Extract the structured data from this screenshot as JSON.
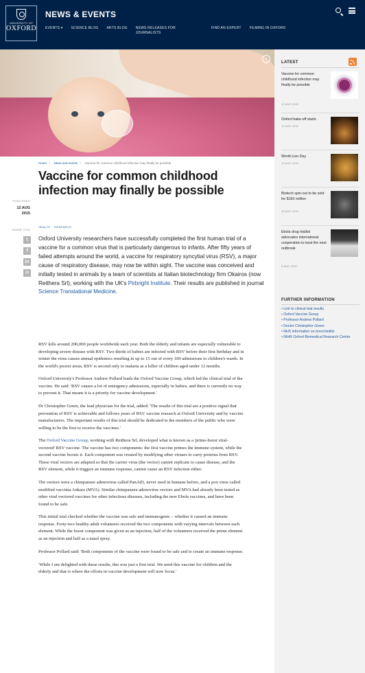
{
  "header": {
    "logo_top": "UNIVERSITY OF",
    "logo_main": "OXFORD",
    "section_title": "NEWS & EVENTS",
    "nav": [
      {
        "label": "EVENTS ▾"
      },
      {
        "label": "SCIENCE BLOG"
      },
      {
        "label": "ARTS BLOG"
      },
      {
        "label": "NEWS RELEASES FOR JOURNALISTS"
      },
      {
        "label": "FIND AN EXPERT"
      },
      {
        "label": "FILMING IN OXFORD"
      }
    ],
    "search_icon": "search-icon",
    "menu_icon": "menu-icon"
  },
  "hero": {
    "info_glyph": "i"
  },
  "breadcrumb": {
    "home": "Home",
    "section": "News and events",
    "current": "Vaccine for common childhood infection may finally be possible",
    "separator": "〉"
  },
  "article": {
    "published_label": "PUBLISHED",
    "date_line1": "12 AUG",
    "date_line2": "2015",
    "share_label": "SHARE THIS",
    "share_icons": [
      "twitter-icon",
      "facebook-icon",
      "linkedin-icon",
      "email-icon"
    ],
    "share_glyphs": [
      "t",
      "f",
      "in",
      "✉"
    ],
    "title": "Vaccine for common childhood infection may finally be possible",
    "tags": [
      "HEALTH",
      "RESEARCH"
    ],
    "lede_before_link": "Oxford University researchers have successfully completed the first human trial of a vaccine for a common virus that is particularly dangerous to infants. After fifty years of failed attempts around the world, a vaccine for respiratory syncytial virus (RSV), a major cause of respiratory disease, may now be within sight. The vaccine was conceived and initially tested in animals by a team of scientists at Italian biotechnology firm Okairos (now Reithera Srl), working with the UK's ",
    "lede_link1": "Pirbright Institute",
    "lede_middle": ". Their results are published in journal ",
    "lede_link2": "Science Translational Medicine",
    "lede_end": ".",
    "paragraphs": [
      "RSV kills around 200,000 people worldwide each year. Both the elderly and infants are especially vulnerable to developing severe disease with RSV. Two-thirds of babies are infected with RSV before their first birthday and in winter the virus causes annual epidemics resulting in up to 15 out of every 100 admissions to children's wards. In the world's poorer areas, RSV is second only to malaria as a killer of children aged under 12 months.",
      "Oxford University's Professor Andrew Pollard leads the Oxford Vaccine Group, which led the clinical trial of the vaccine. He said: 'RSV causes a lot of emergency admissions, especially in babies, and there is currently no way to prevent it. That means it is a priority for vaccine development.'",
      "Dr Christopher Green, the lead physician for the trial, added: 'The results of this trial are a positive signal that prevention of RSV is achievable and follows years of RSV vaccine research at Oxford University and by vaccine manufacturers. The important results of this trial should be dedicated to the members of the public who were willing to be the first to receive the vaccines.'"
    ],
    "p4_before": "The ",
    "p4_link": "Oxford Vaccine Group",
    "p4_after": ", working with Reithera Srl, developed what is known as a 'prime-boost viral-vectored' RSV vaccine. The vaccine has two components: the first vaccine primes the immune system, while the second vaccine boosts it. Each component was created by modifying other viruses to carry proteins from RSV. These viral vectors are adapted so that the carrier virus (the vector) cannot replicate to cause disease, and the RSV element, while it triggers an immune response, cannot cause an RSV infection either.",
    "paragraphs_after": [
      "The vectors were a chimpanzee adenovirus called PanAd3, never used in humans before, and a pox virus called modified vaccinia Ankara (MVA). Similar chimpanzee adenovirus vectors and MVA had already been tested as other viral vectored vaccines for other infectious diseases, including the new Ebola vaccines, and have been found to be safe.",
      "This initial trial checked whether the vaccine was safe and immunogenic – whether it caused an immune response. Forty-two healthy adult volunteers received the two components with varying intervals between each element. While the boost component was given as an injection, half of the volunteers received the prime element as an injection and half as a nasal spray.",
      "Professor Pollard said: 'Both components of the vaccine were found to be safe and to create an immune response.",
      "'While I am delighted with these results, this was just a first trial. We need this vaccine for children and the elderly and that is where the efforts in vaccine development will now focus.'"
    ]
  },
  "sidebar": {
    "latest_heading": "LATEST",
    "rss_icon": "rss-icon",
    "latest": [
      {
        "title": "Vaccine for common childhood infection may finally be possible",
        "date": "12 AUG 2015",
        "thumb": "virus-thumbnail"
      },
      {
        "title": "Oxford bake-off starts",
        "date": "11 AUG 2015",
        "thumb": "bakery-thumbnail"
      },
      {
        "title": "World Lion Day",
        "date": "10 AUG 2015",
        "thumb": "lion-thumbnail"
      },
      {
        "title": "Biotech spin-out to be sold for $160 million",
        "date": "10 AUG 2015",
        "thumb": "insect-thumbnail"
      },
      {
        "title": "Ebola drug triallist advocates international cooperation to beat the next outbreak",
        "date": "6 AUG 2015",
        "thumb": "book-thumbnail"
      }
    ],
    "further_heading": "FURTHER INFORMATION",
    "further_links": [
      "Link to clinical trial results",
      "Oxford Vaccine Group",
      "Professor Andrew Pollard",
      "Doctor Christopher Green",
      "NHS information on bronchiolitis",
      "NIHR Oxford Biomedical Research Centre"
    ]
  }
}
